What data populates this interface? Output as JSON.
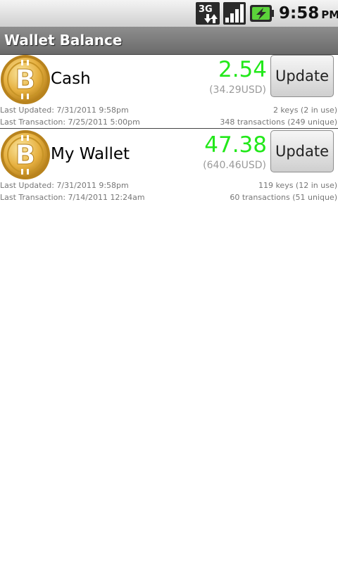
{
  "status_bar": {
    "network_label": "3G",
    "time": "9:58",
    "ampm": "PM",
    "icons": [
      "3g-data-icon",
      "signal-strength-icon",
      "battery-charging-icon"
    ]
  },
  "title_bar": {
    "title": "Wallet Balance"
  },
  "wallets": [
    {
      "icon": "bitcoin-coin-icon",
      "name": "Cash",
      "balance": "2.54",
      "balance_usd": "(34.29USD)",
      "update_label": "Update",
      "last_updated": "Last Updated: 7/31/2011 9:58pm",
      "last_transaction": "Last Transaction: 7/25/2011 5:00pm",
      "keys": "2 keys (2 in use)",
      "transactions": "348 transactions (249 unique)"
    },
    {
      "icon": "bitcoin-coin-icon",
      "name": "My Wallet",
      "balance": "47.38",
      "balance_usd": "(640.46USD)",
      "update_label": "Update",
      "last_updated": "Last Updated: 7/31/2011 9:58pm",
      "last_transaction": "Last Transaction: 7/14/2011 12:24am",
      "keys": "119 keys (12 in use)",
      "transactions": "60 transactions (51 unique)"
    }
  ],
  "colors": {
    "balance_green": "#22e81a",
    "coin_gold": "#e2a92a",
    "title_bar_gray": "#7b7b7b"
  }
}
